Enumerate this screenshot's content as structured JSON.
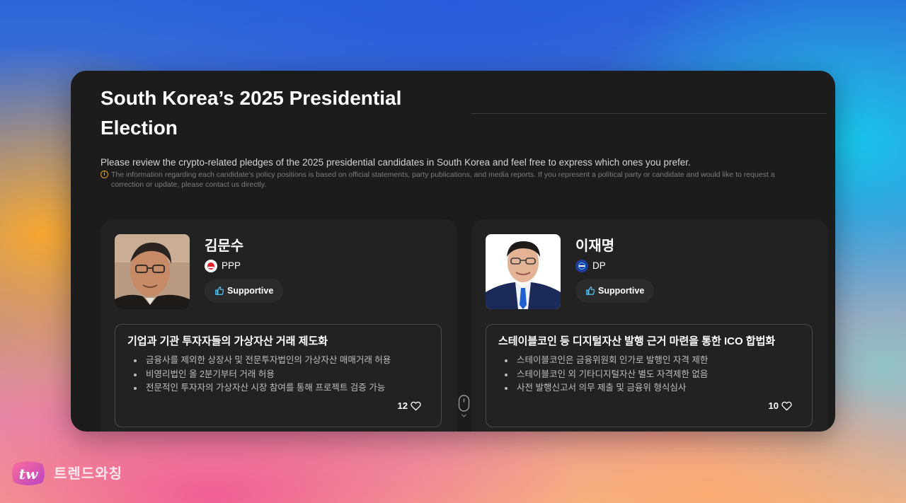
{
  "header": {
    "title": "South Korea’s 2025 Presidential Election",
    "description": "Please review the crypto-related pledges of the 2025 presidential candidates in South Korea and feel free to express which ones you prefer.",
    "note": "The information regarding each candidate’s policy positions is based on official statements, party publications, and media reports. If you represent a political party or candidate and would like to request a correction or update, please contact us directly.",
    "note_icon": "info-icon"
  },
  "candidates": [
    {
      "name": "김문수",
      "party": "PPP",
      "party_color": "#e61e2b",
      "support_label": "Supportive",
      "pledge": {
        "title": "기업과 기관 투자자들의 가상자산 거래 제도화",
        "items": [
          "금융사를 제외한 상장사 및 전문투자법인의 가상자산 매매거래 허용",
          "비영리법인 올 2분기부터 거래 허용",
          "전문적인 투자자의 가상자산 시장 참여를 통해 프로젝트 검증 가능"
        ],
        "likes": "12"
      }
    },
    {
      "name": "이재명",
      "party": "DP",
      "party_color": "#1e3ca0",
      "support_label": "Supportive",
      "pledge": {
        "title": "스테이블코인 등 디지털자산 발행 근거 마련을 통한 ICO 합법화",
        "items": [
          "스테이블코인은 금융위원회 인가로 발행인 자격 제한",
          "스테이블코인 외 기타디지털자산 별도 자격제한 없음",
          "사전 발행신고서 의무 제출 및 금융위 형식심사"
        ],
        "likes": "10"
      }
    }
  ],
  "icons": {
    "support": "thumbs-up-icon",
    "like": "heart-icon",
    "scroll": "mouse-scroll-icon"
  },
  "brand": {
    "name": "트렌드와칭",
    "logo_text": "tw"
  }
}
